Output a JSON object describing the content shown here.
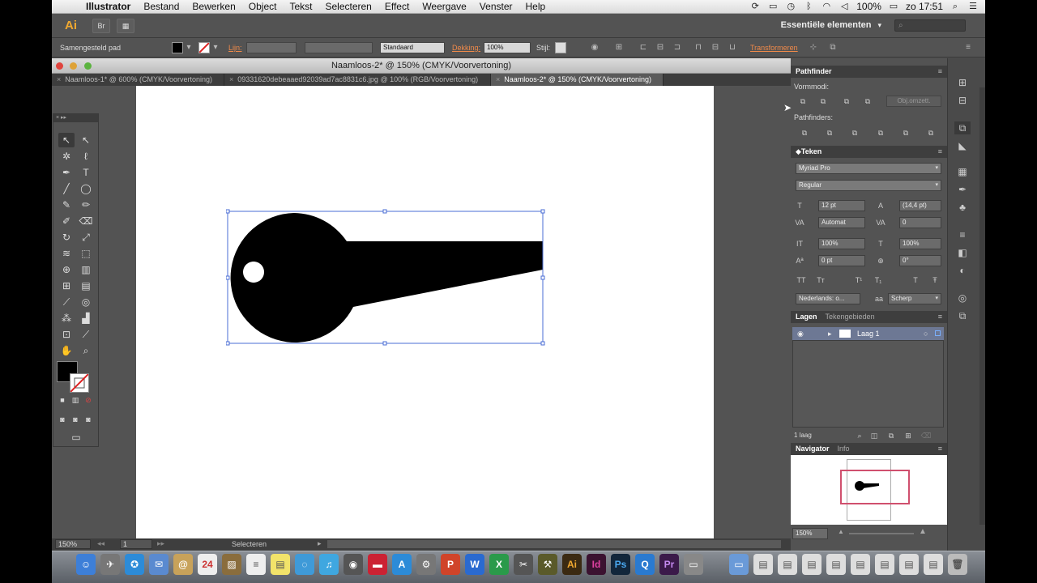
{
  "menubar": {
    "app_name": "Illustrator",
    "items": [
      "Bestand",
      "Bewerken",
      "Object",
      "Tekst",
      "Selecteren",
      "Effect",
      "Weergave",
      "Venster",
      "Help"
    ],
    "battery": "100%",
    "clock": "zo 17:51"
  },
  "appbar": {
    "logo": "Ai",
    "bridge_label": "Br",
    "workspace": "Essentiële elementen",
    "search_placeholder": ""
  },
  "controlbar": {
    "selection_type": "Samengesteld pad",
    "stroke_label": "Lijn:",
    "stroke_style": "Standaard",
    "opacity_label": "Dekking:",
    "opacity_value": "100%",
    "style_label": "Stijl:",
    "transform_link": "Transformeren"
  },
  "document": {
    "window_title": "Naamloos-2* @ 150% (CMYK/Voorvertoning)",
    "tabs": [
      {
        "label": "Naamloos-1* @ 600% (CMYK/Voorvertoning)",
        "active": false
      },
      {
        "label": "09331620debeaaed92039ad7ac8831c6.jpg @ 100% (RGB/Voorvertoning)",
        "active": false
      },
      {
        "label": "Naamloos-2* @ 150% (CMYK/Voorvertoning)",
        "active": true
      }
    ]
  },
  "statusbar": {
    "zoom": "150%",
    "artboard": "1",
    "tool_status": "Selecteren"
  },
  "pathfinder": {
    "title": "Pathfinder",
    "shape_modes_label": "Vormmodi:",
    "expand_button": "Obj.omzett.",
    "pathfinders_label": "Pathfinders:"
  },
  "character": {
    "title": "Teken",
    "font_family": "Myriad Pro",
    "font_style": "Regular",
    "font_size": "12 pt",
    "leading": "(14,4 pt)",
    "kerning": "Automat",
    "tracking": "0",
    "vscale": "100%",
    "hscale": "100%",
    "baseline": "0 pt",
    "rotation": "0°",
    "language": "Nederlands: o...",
    "antialias": "Scherp"
  },
  "layers": {
    "tab_active": "Lagen",
    "tab_other": "Tekengebieden",
    "layer_name": "Laag 1",
    "count": "1 laag"
  },
  "navigator": {
    "tab_active": "Navigator",
    "tab_other": "Info",
    "zoom": "150%"
  },
  "colors": {
    "accent": "#f0a830",
    "selection": "#4a6cd4",
    "layer_highlight": "#6d7894",
    "transform_link": "#f08a4a"
  }
}
